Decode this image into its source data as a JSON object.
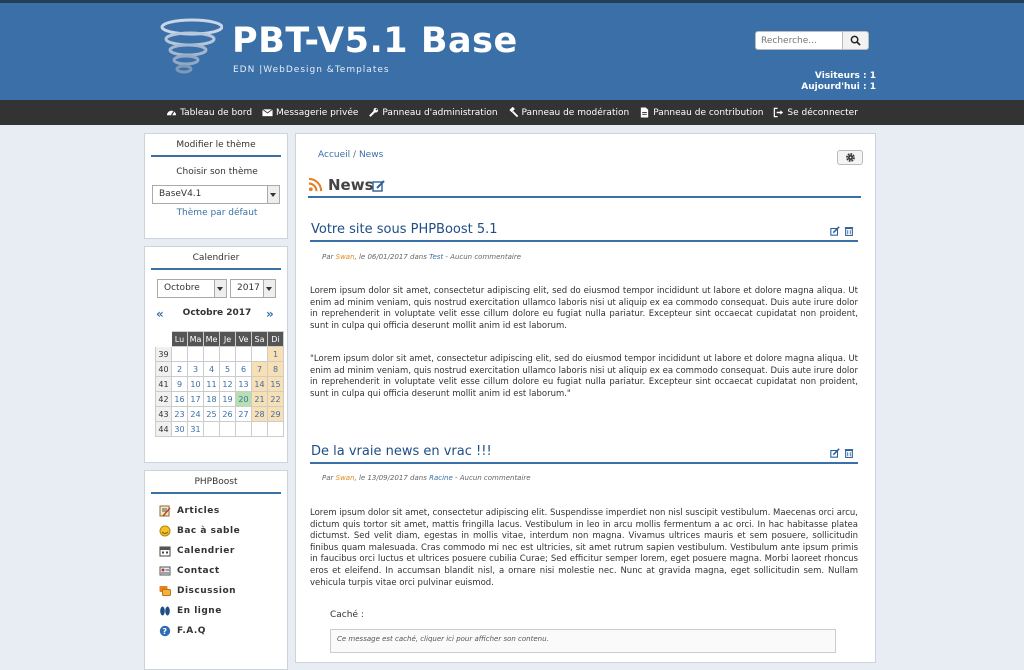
{
  "header": {
    "title": "PBT-V5.1 Base",
    "subtitle": "EDN |WebDesign &Templates",
    "search_placeholder": "Recherche...",
    "visitors": "Visiteurs : 1",
    "today": "Aujourd'hui : 1",
    "colors": {
      "bar": "#3a6fa8",
      "menu": "#333333"
    }
  },
  "menu": [
    {
      "label": "Tableau de bord",
      "icon": "dashboard-icon"
    },
    {
      "label": "Messagerie privée",
      "icon": "envelope-icon"
    },
    {
      "label": "Panneau d'administration",
      "icon": "wrench-icon"
    },
    {
      "label": "Panneau de modération",
      "icon": "gavel-icon"
    },
    {
      "label": "Panneau de contribution",
      "icon": "file-icon"
    },
    {
      "label": "Se déconnecter",
      "icon": "sign-out-icon"
    }
  ],
  "theme_panel": {
    "title": "Modifier le thème",
    "choose_label": "Choisir son thème",
    "selected": "BaseV4.1",
    "default_link": "Thème par défaut"
  },
  "calendar": {
    "title": "Calendrier",
    "month_select": "Octobre",
    "year_select": "2017",
    "caption": "Octobre 2017",
    "prev": "«",
    "next": "»",
    "days": [
      "Lu",
      "Ma",
      "Me",
      "Je",
      "Ve",
      "Sa",
      "Di"
    ],
    "weeks": [
      {
        "wk": "39",
        "days": [
          "",
          "",
          "",
          "",
          "",
          "",
          "1"
        ]
      },
      {
        "wk": "40",
        "days": [
          "2",
          "3",
          "4",
          "5",
          "6",
          "7",
          "8"
        ]
      },
      {
        "wk": "41",
        "days": [
          "9",
          "10",
          "11",
          "12",
          "13",
          "14",
          "15"
        ]
      },
      {
        "wk": "42",
        "days": [
          "16",
          "17",
          "18",
          "19",
          "20",
          "21",
          "22"
        ]
      },
      {
        "wk": "43",
        "days": [
          "23",
          "24",
          "25",
          "26",
          "27",
          "28",
          "29"
        ]
      },
      {
        "wk": "44",
        "days": [
          "30",
          "31",
          "",
          "",
          "",
          "",
          ""
        ]
      }
    ],
    "today": "20"
  },
  "phpboost_panel": {
    "title": "PHPBoost",
    "items": [
      {
        "label": "Articles",
        "icon": "articles-icon"
      },
      {
        "label": "Bac à sable",
        "icon": "sandbox-icon"
      },
      {
        "label": "Calendrier",
        "icon": "calendar-icon"
      },
      {
        "label": "Contact",
        "icon": "contact-icon"
      },
      {
        "label": "Discussion",
        "icon": "discussion-icon"
      },
      {
        "label": "En ligne",
        "icon": "online-icon"
      },
      {
        "label": "F.A.Q",
        "icon": "faq-icon"
      }
    ]
  },
  "main": {
    "breadcrumb_home": "Accueil",
    "breadcrumb_sep": "/",
    "breadcrumb_current": "News",
    "page_title": "News",
    "articles": [
      {
        "title": "Votre site sous PHPBoost 5.1",
        "meta_by": "Par ",
        "author": "Swan",
        "meta_date": ", le 06/01/2017 dans ",
        "category": "Test",
        "meta_comments": " - Aucun commentaire",
        "p1": "Lorem ipsum dolor sit amet, consectetur adipiscing elit, sed do eiusmod tempor incididunt ut labore et dolore magna aliqua. Ut enim ad minim veniam, quis nostrud exercitation ullamco laboris nisi ut aliquip ex ea commodo consequat. Duis aute irure dolor in reprehenderit in voluptate velit esse cillum dolore eu fugiat nulla pariatur. Excepteur sint occaecat cupidatat non proident, sunt in culpa qui officia deserunt mollit anim id est laborum.",
        "p2": "\"Lorem ipsum dolor sit amet, consectetur adipiscing elit, sed do eiusmod tempor incididunt ut labore et dolore magna aliqua. Ut enim ad minim veniam, quis nostrud exercitation ullamco laboris nisi ut aliquip ex ea commodo consequat. Duis aute irure dolor in reprehenderit in voluptate velit esse cillum dolore eu fugiat nulla pariatur. Excepteur sint occaecat cupidatat non proident, sunt in culpa qui officia deserunt mollit anim id est laborum.\""
      },
      {
        "title": "De la vraie news en vrac !!!",
        "meta_by": "Par ",
        "author": "Swan",
        "meta_date": ", le 13/09/2017 dans ",
        "category": "Racine",
        "meta_comments": " - Aucun commentaire",
        "p1": "Lorem ipsum dolor sit amet, consectetur adipiscing elit. Suspendisse imperdiet non nisl suscipit vestibulum. Maecenas orci arcu, dictum quis tortor sit amet, mattis fringilla lacus. Vestibulum in leo in arcu mollis fermentum a ac orci. In hac habitasse platea dictumst. Sed velit diam, egestas in mollis vitae, interdum non magna. Vivamus ultrices mauris et sem posuere, sollicitudin finibus quam malesuada. Cras commodo mi nec est ultricies, sit amet rutrum sapien vestibulum. Vestibulum ante ipsum primis in faucibus orci luctus et ultrices posuere cubilia Curae; Sed efficitur semper lorem, eget posuere magna. Morbi laoreet rhoncus eros et eleifend. In accumsan blandit nisl, a ornare nisi molestie nec. Nunc at gravida magna, eget sollicitudin sem. Nullam vehicula turpis vitae orci pulvinar euismod.",
        "hidden_label": "Caché :",
        "hidden_text": "Ce message est caché, cliquer ici pour afficher son contenu."
      }
    ]
  }
}
